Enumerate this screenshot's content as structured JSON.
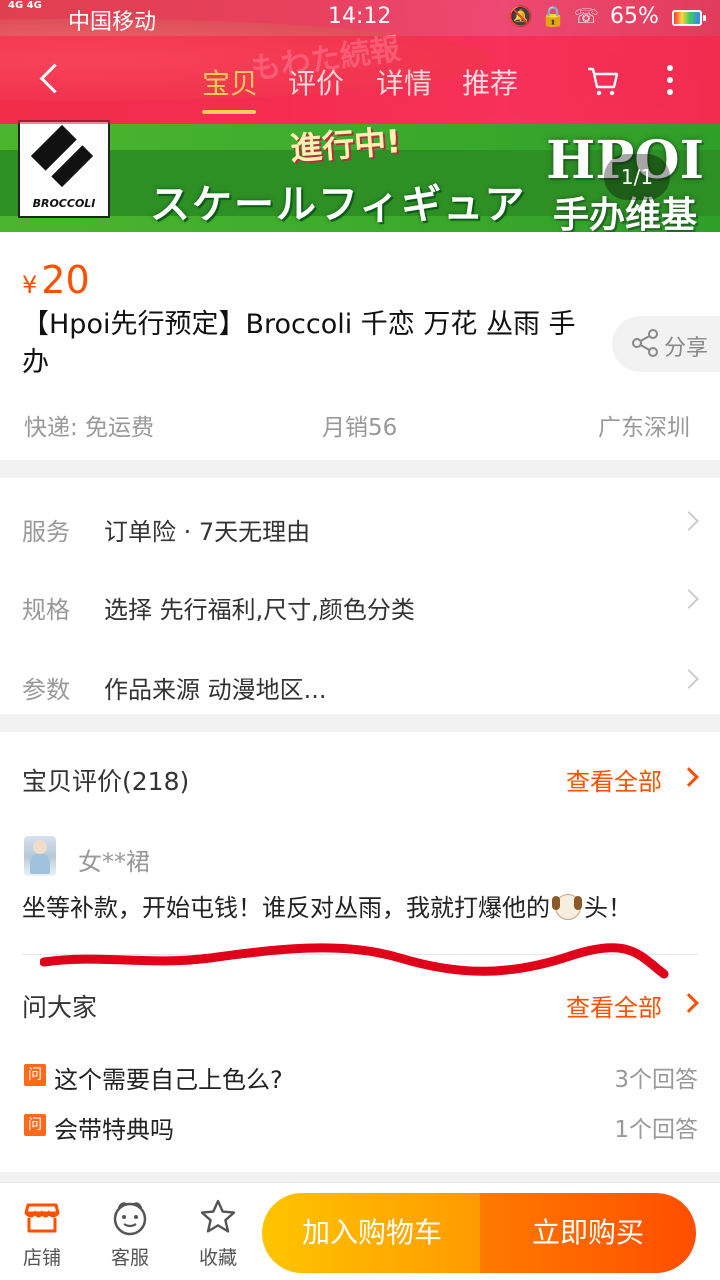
{
  "status_bar": {
    "network": "4G 4G",
    "carrier": "中国移动",
    "time": "14:12",
    "battery": "65%"
  },
  "nav": {
    "tabs": [
      {
        "label": "宝贝",
        "active": true
      },
      {
        "label": "评价",
        "active": false
      },
      {
        "label": "详情",
        "active": false
      },
      {
        "label": "推荐",
        "active": false
      }
    ]
  },
  "banner": {
    "brand_logo_text": "BROCCOLI",
    "headline_jp": "スケールフィギュア",
    "deco_text": "進行中!",
    "hpoi_title": "HPOI",
    "hpoi_subtitle": "手办维基",
    "image_index": "1/1"
  },
  "product": {
    "currency": "¥",
    "price": "20",
    "title": "【Hpoi先行预定】Broccoli 千恋 万花 丛雨 手办",
    "share_label": "分享",
    "shipping": "快递: 免运费",
    "monthly_sales": "月销56",
    "location": "广东深圳"
  },
  "specs": [
    {
      "label": "服务",
      "value": "订单险 · 7天无理由"
    },
    {
      "label": "规格",
      "value": "选择 先行福利,尺寸,颜色分类"
    },
    {
      "label": "参数",
      "value": "作品来源 动漫地区..."
    }
  ],
  "reviews": {
    "title": "宝贝评价(218)",
    "view_all": "查看全部",
    "reviewer": "女**裙",
    "text_before": "坐等补款，开始屯钱！谁反对丛雨，我就打爆他的",
    "text_after": "头！",
    "emoji": "dog-face-icon"
  },
  "qa": {
    "title": "问大家",
    "view_all": "查看全部",
    "badge": "问",
    "items": [
      {
        "question": "这个需要自己上色么?",
        "answers": "3个回答"
      },
      {
        "question": "会带特典吗",
        "answers": "1个回答"
      }
    ]
  },
  "bottom_bar": {
    "shop": "店铺",
    "service": "客服",
    "favorite": "收藏",
    "add_to_cart": "加入购物车",
    "buy_now": "立即购买"
  },
  "colors": {
    "accent": "#ff5000",
    "cart_button": "#ffb000",
    "buy_button": "#ff5a00",
    "scribble": "#e0001a"
  }
}
